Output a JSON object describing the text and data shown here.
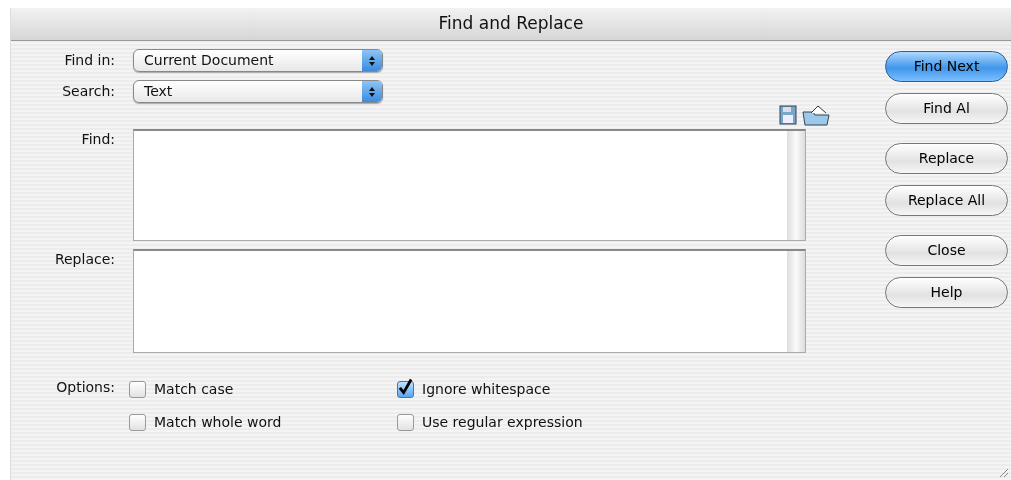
{
  "window": {
    "title": "Find and Replace"
  },
  "find_in": {
    "label": "Find in:",
    "value": "Current Document"
  },
  "search": {
    "label": "Search:",
    "value": "Text"
  },
  "find": {
    "label": "Find:"
  },
  "replace": {
    "label": "Replace:"
  },
  "options": {
    "label": "Options:",
    "items": [
      {
        "label": "Match case",
        "checked": false
      },
      {
        "label": "Ignore whitespace",
        "checked": true
      },
      {
        "label": "Match whole word",
        "checked": false
      },
      {
        "label": "Use regular expression",
        "checked": false
      }
    ]
  },
  "button_groups": [
    [
      {
        "label": "Find Next",
        "default": true
      },
      {
        "label": "Find Al",
        "default": false
      }
    ],
    [
      {
        "label": "Replace",
        "default": false
      },
      {
        "label": "Replace All",
        "default": false
      }
    ],
    [
      {
        "label": "Close",
        "default": false
      },
      {
        "label": "Help",
        "default": false
      }
    ]
  ]
}
